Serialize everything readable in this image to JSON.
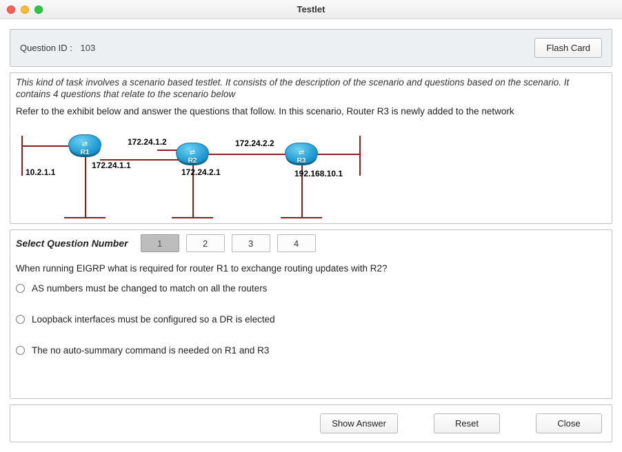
{
  "window": {
    "title": "Testlet"
  },
  "header": {
    "qid_label": "Question ID :",
    "qid_value": "103",
    "flash_card_label": "Flash Card"
  },
  "scenario": {
    "description": "This kind of task involves a scenario based testlet. It consists of the description of the scenario and questions based on the scenario. It contains 4 questions that relate to the scenario below",
    "instruction": "Refer to the exhibit below and answer the questions that follow. In this scenario, Router R3 is newly added to the network",
    "topology": {
      "routers": [
        {
          "name": "R1"
        },
        {
          "name": "R2"
        },
        {
          "name": "R3"
        }
      ],
      "ip_labels": {
        "r1_left": "10.2.1.1",
        "r1_right": "172.24.1.1",
        "r2_left": "172.24.1.2",
        "r2_right": "172.24.2.1",
        "r3_left": "172.24.2.2",
        "r3_right": "192.168.10.1"
      }
    }
  },
  "question": {
    "select_label": "Select Question Number",
    "tabs": [
      "1",
      "2",
      "3",
      "4"
    ],
    "active_tab_index": 0,
    "text": "When running EIGRP what is required for router R1 to exchange routing updates with R2?",
    "options": [
      "AS numbers must be changed to match on all the routers",
      "Loopback interfaces must be configured so a DR is elected",
      "The no auto-summary command is needed on R1 and R3"
    ]
  },
  "footer": {
    "show_answer_label": "Show Answer",
    "reset_label": "Reset",
    "close_label": "Close"
  }
}
